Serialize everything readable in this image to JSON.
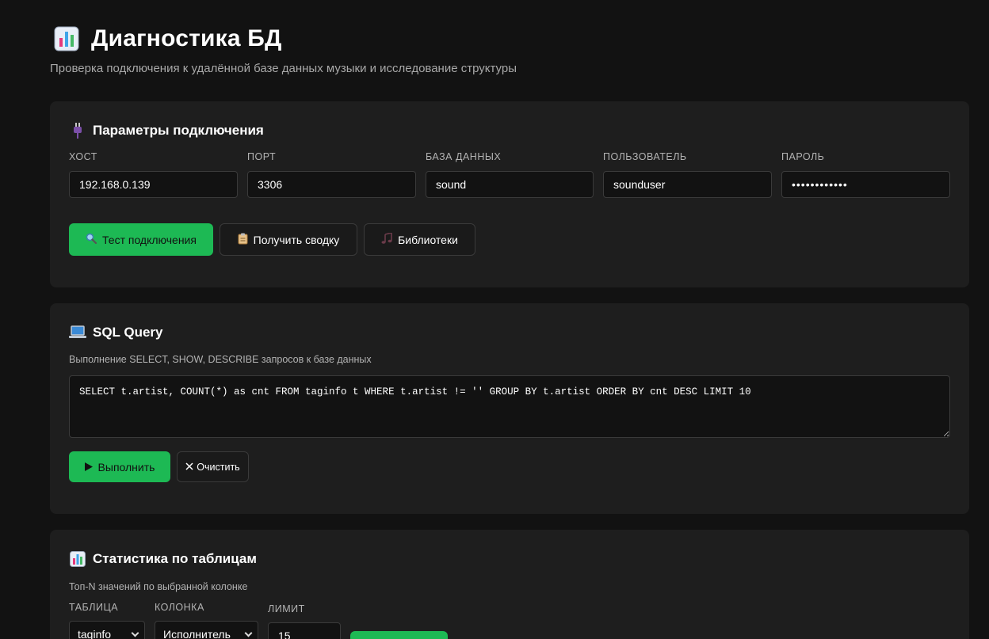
{
  "header": {
    "title": "Диагностика БД",
    "subtitle": "Проверка подключения к удалённой базе данных музыки и исследование структуры",
    "icon": "bar-chart-icon"
  },
  "connection": {
    "title": "Параметры подключения",
    "icon": "plug-icon",
    "fields": {
      "host": {
        "label": "ХОСТ",
        "value": "192.168.0.139"
      },
      "port": {
        "label": "ПОРТ",
        "value": "3306"
      },
      "database": {
        "label": "БАЗА ДАННЫХ",
        "value": "sound"
      },
      "user": {
        "label": "ПОЛЬЗОВАТЕЛЬ",
        "value": "sounduser"
      },
      "password": {
        "label": "ПАРОЛЬ",
        "value": "••••••••••••"
      }
    },
    "buttons": {
      "test": {
        "label": "Тест подключения",
        "icon": "magnifier-icon"
      },
      "summary": {
        "label": "Получить сводку",
        "icon": "clipboard-icon"
      },
      "libraries": {
        "label": "Библиотеки",
        "icon": "music-note-icon"
      }
    }
  },
  "sql": {
    "title": "SQL Query",
    "icon": "laptop-icon",
    "description": "Выполнение SELECT, SHOW, DESCRIBE запросов к базе данных",
    "query": "SELECT t.artist, COUNT(*) as cnt FROM taginfo t WHERE t.artist != '' GROUP BY t.artist ORDER BY cnt DESC LIMIT 10",
    "run_label": "Выполнить",
    "clear_label": "Очистить"
  },
  "stats": {
    "title": "Статистика по таблицам",
    "icon": "bar-chart-icon",
    "description": "Топ-N значений по выбранной колонке",
    "table_label": "ТАБЛИЦА",
    "table_value": "taginfo",
    "column_label": "КОЛОНКА",
    "column_value": "Исполнитель",
    "limit_label": "ЛИМИТ",
    "limit_value": "15"
  },
  "colors": {
    "accent": "#1db954",
    "background": "#121212",
    "card": "#1e1e1e"
  }
}
